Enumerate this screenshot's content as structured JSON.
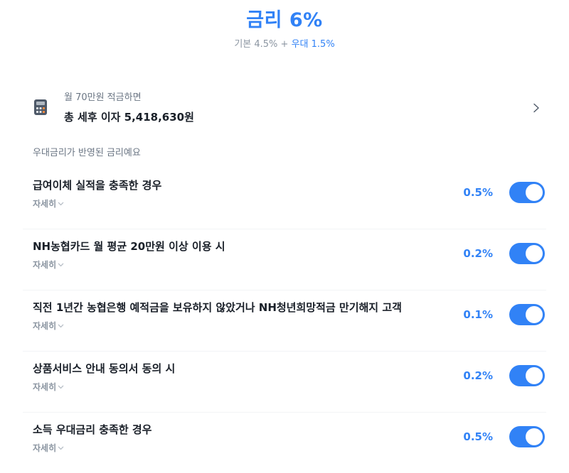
{
  "header": {
    "title": "금리 6%",
    "sub_base": "기본 4.5%",
    "sub_plus": "+",
    "sub_bonus": "우대 1.5%"
  },
  "calculator": {
    "icon": "calculator-icon",
    "label": "월 70만원 적금하면",
    "value": "총 세후 이자 5,418,630원",
    "chevron_icon": "chevron-right-icon"
  },
  "section_caption": "우대금리가 반영된 금리예요",
  "conditions": [
    {
      "title": "급여이체 실적을 충족한 경우",
      "detail": "자세히",
      "rate": "0.5%",
      "enabled": true
    },
    {
      "title": "NH농협카드 월 평균 20만원 이상 이용 시",
      "detail": "자세히",
      "rate": "0.2%",
      "enabled": true
    },
    {
      "title": "직전 1년간 농협은행 예적금을 보유하지 않았거나 NH청년희망적금 만기해지 고객",
      "detail": "자세히",
      "rate": "0.1%",
      "enabled": true
    },
    {
      "title": "상품서비스 안내 동의서 동의 시",
      "detail": "자세히",
      "rate": "0.2%",
      "enabled": true
    },
    {
      "title": "소득 우대금리 충족한 경우",
      "detail": "자세히",
      "rate": "0.5%",
      "enabled": true
    }
  ],
  "colors": {
    "accent": "#3182f6",
    "toggle_on": "#3182f6",
    "muted_text": "#8b95a1"
  }
}
